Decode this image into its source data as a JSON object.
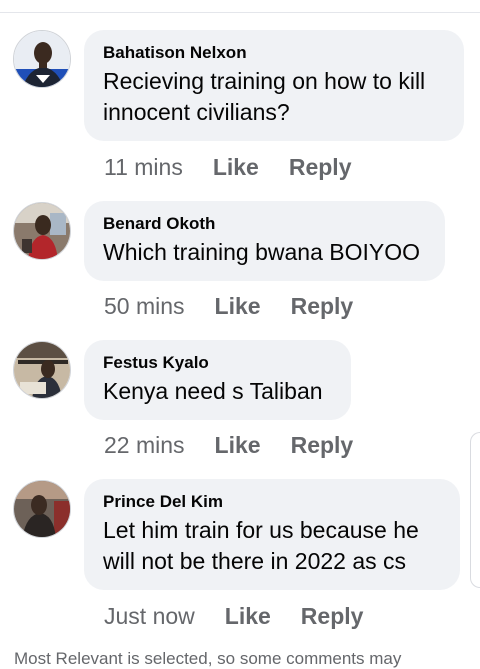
{
  "comments": [
    {
      "author": "Bahatison Nelxon",
      "text": "Recieving training on how to kill innocent civilians?",
      "time": "11 mins",
      "like_label": "Like",
      "reply_label": "Reply"
    },
    {
      "author": "Benard Okoth",
      "text": "Which training bwana BOIYOO",
      "time": "50 mins",
      "like_label": "Like",
      "reply_label": "Reply"
    },
    {
      "author": "Festus Kyalo",
      "text": "Kenya need s Taliban",
      "time": "22 mins",
      "like_label": "Like",
      "reply_label": "Reply"
    },
    {
      "author": "Prince Del Kim",
      "text": "Let him train for us  because he will not be there in 2022 as cs",
      "time": "Just now",
      "like_label": "Like",
      "reply_label": "Reply"
    }
  ],
  "footer": {
    "note": "Most Relevant is selected, so some comments may"
  },
  "colors": {
    "bubble_bg": "#f0f2f5",
    "meta_text": "#65676b",
    "body_text": "#050505"
  }
}
